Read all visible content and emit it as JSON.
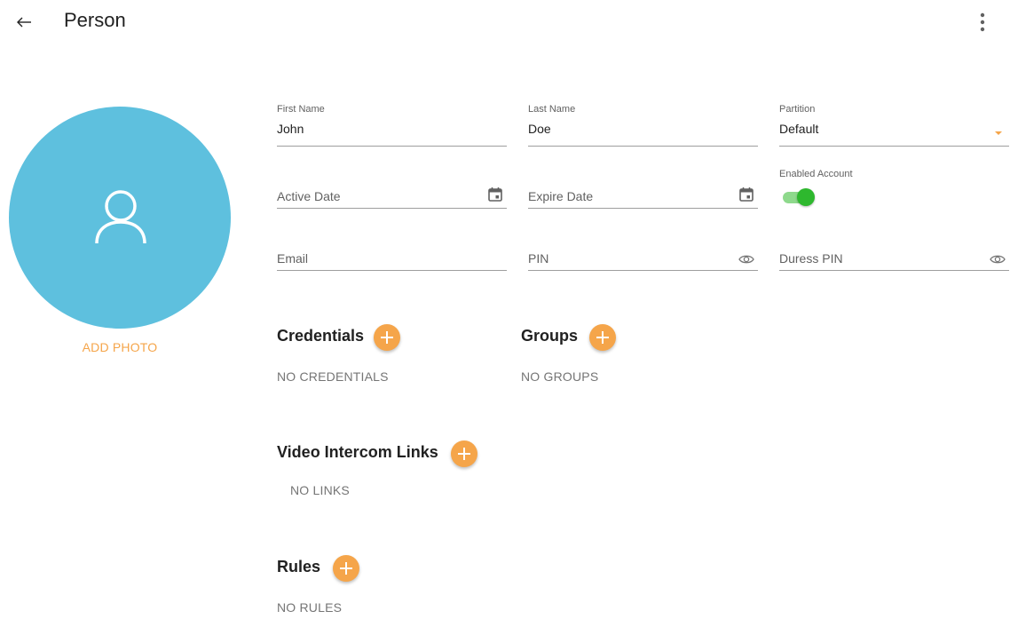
{
  "header": {
    "title": "Person",
    "back_icon": "arrow-left-icon",
    "menu_icon": "more-vert-icon"
  },
  "photo": {
    "add_label": "ADD PHOTO",
    "avatar_icon": "person-icon",
    "avatar_color": "#5ec0de"
  },
  "form": {
    "first_name": {
      "label": "First Name",
      "value": "John"
    },
    "last_name": {
      "label": "Last Name",
      "value": "Doe"
    },
    "partition": {
      "label": "Partition",
      "value": "Default"
    },
    "active_date": {
      "placeholder": "Active Date"
    },
    "expire_date": {
      "placeholder": "Expire Date"
    },
    "enabled_account": {
      "label": "Enabled Account",
      "enabled": true
    },
    "email": {
      "placeholder": "Email"
    },
    "pin": {
      "placeholder": "PIN"
    },
    "duress_pin": {
      "placeholder": "Duress PIN"
    }
  },
  "sections": {
    "credentials": {
      "title": "Credentials",
      "empty": "NO CREDENTIALS"
    },
    "groups": {
      "title": "Groups",
      "empty": "NO GROUPS"
    },
    "video_intercom_links": {
      "title": "Video Intercom Links",
      "empty": "NO LINKS"
    },
    "rules": {
      "title": "Rules",
      "empty": "NO RULES"
    }
  },
  "colors": {
    "accent": "#f5a54a",
    "toggle_on": "#2eb82e",
    "avatar": "#5ec0de"
  }
}
